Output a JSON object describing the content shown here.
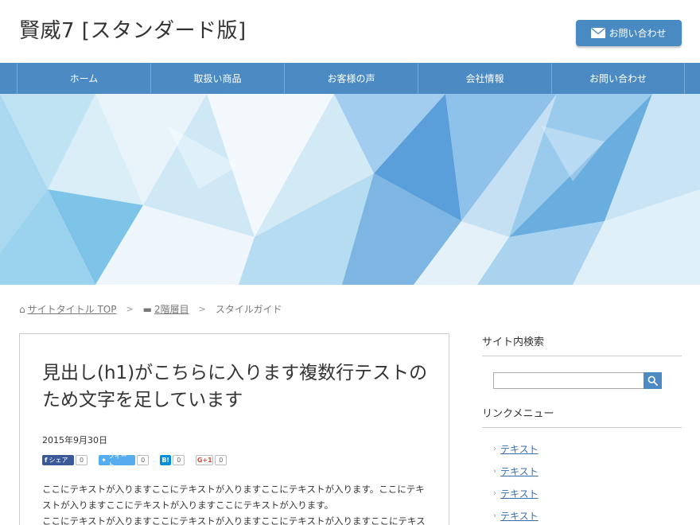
{
  "header": {
    "site_title": "賢威7 [スタンダード版]",
    "contact_button": "お問い合わせ"
  },
  "nav": {
    "items": [
      "ホーム",
      "取扱い商品",
      "お客様の声",
      "会社情報",
      "お問い合わせ"
    ]
  },
  "breadcrumb": {
    "home": "サイトタイトル TOP",
    "level2": "2階層目",
    "current": "スタイルガイド"
  },
  "post": {
    "title": "見出し(h1)がこちらに入ります複数行テストのため文字を足しています",
    "date": "2015年9月30日",
    "share": {
      "facebook_label": "シェア",
      "facebook_count": "0",
      "twitter_label": "ツイート",
      "twitter_count": "0",
      "hatena_label": "B!",
      "hatena_count": "0",
      "gplus_label": "G+1",
      "gplus_count": "0"
    },
    "body_lines": [
      "ここにテキストが入りますここにテキストが入りますここにテキストが入ります。ここにテキストが入りますここにテキストが入りますここにテキストが入ります。",
      "ここにテキストが入りますここにテキストが入りますここにテキストが入りますここにテキスト"
    ]
  },
  "sidebar": {
    "search_title": "サイト内検索",
    "link_menu_title": "リンクメニュー",
    "links": [
      "テキスト",
      "テキスト",
      "テキスト",
      "テキスト"
    ]
  },
  "colors": {
    "accent": "#4b8ac3",
    "link": "#3a6ea8"
  }
}
